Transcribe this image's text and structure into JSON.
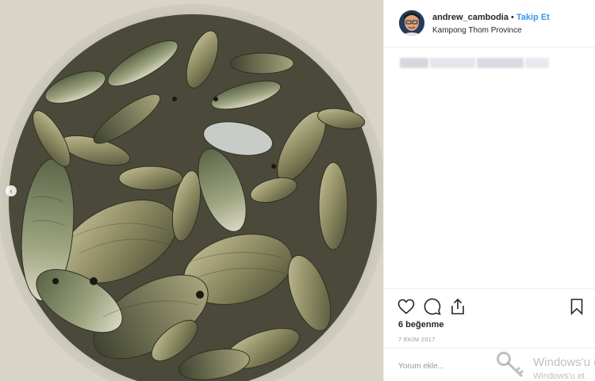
{
  "post": {
    "username": "andrew_cambodia",
    "separator": "•",
    "follow_label": "Takip Et",
    "location": "Kampong Thom Province",
    "likes": "6 beğenme",
    "date": "7 EKİM 2017",
    "comment_placeholder": "Yorum ekle...",
    "carousel_indicator": "‹"
  },
  "icons": {
    "like": "heart-icon",
    "comment": "comment-bubble-icon",
    "share": "share-icon",
    "save": "bookmark-icon",
    "watermark": "key-icon"
  },
  "watermark": {
    "line1": "Windows'u e",
    "line2": "Windows'u et"
  },
  "colors": {
    "follow": "#3897f0",
    "text": "#262626",
    "muted": "#999999",
    "divider": "#efefef"
  }
}
